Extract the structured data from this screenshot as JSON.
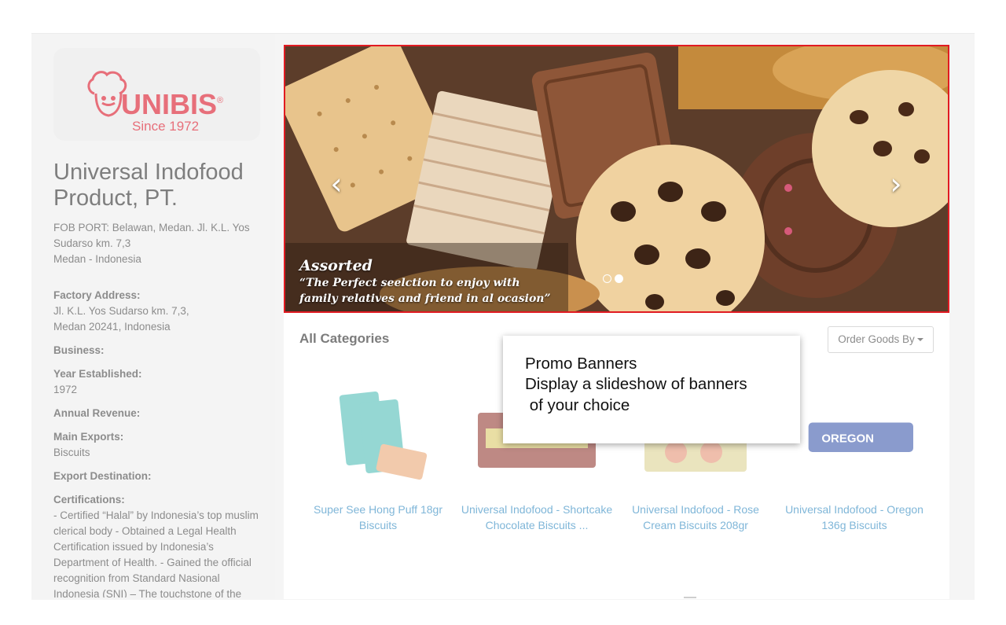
{
  "brand": {
    "logo_text": "UNIBIS",
    "logo_registered": "®",
    "logo_tagline": "Since 1972",
    "logo_color": "#e76f7a"
  },
  "company": {
    "name": "Universal Indofood Product, PT.",
    "address_lines": [
      "FOB PORT: Belawan, Medan. Jl. K.L. Yos Sudarso km. 7,3",
      "Medan - Indonesia"
    ],
    "factory_label": "Factory Address:",
    "factory_value": "Jl. K.L. Yos Sudarso km. 7,3, Medan 20241, Indonesia",
    "business_label": "Business:",
    "year_label": "Year Established:",
    "year_value": "1972",
    "revenue_label": "Annual Revenue:",
    "exports_label": "Main Exports:",
    "exports_value": "Biscuits",
    "destination_label": "Export Destination:",
    "cert_label": "Certifications:",
    "cert_value": "- Certified “Halal” by Indonesia’s top muslim clerical body - Obtained a Legal Health Certification issued by Indonesia’s Department of Health. - Gained the official recognition from Standard Nasional Indonesia (SNI) – The touchstone of the"
  },
  "banner": {
    "caption_title": "Assorted",
    "caption_text": "“The Perfect seelction to enjoy with family relatives and friend in al ocasion”",
    "prev_icon": "chevron-left-icon",
    "next_icon": "chevron-right-icon",
    "prev_glyph": "‹",
    "next_glyph": "›",
    "slide_count": 2,
    "active_slide": 2,
    "highlight_color": "#e11b22"
  },
  "catalog": {
    "heading": "All Categories",
    "order_button": "Order Goods By",
    "products": [
      {
        "title": "Super See Hong Puff 18gr Biscuits"
      },
      {
        "title": "Universal Indofood - Shortcake Chocolate Biscuits ..."
      },
      {
        "title": "Universal Indofood - Rose Cream Biscuits 208gr"
      },
      {
        "title": "Universal Indofood - Oregon 136g Biscuits"
      }
    ],
    "link_color": "#7fb6d8"
  },
  "tooltip": {
    "line1": "Promo Banners",
    "line2": "Display a slideshow of banners",
    "line3": " of your choice"
  }
}
